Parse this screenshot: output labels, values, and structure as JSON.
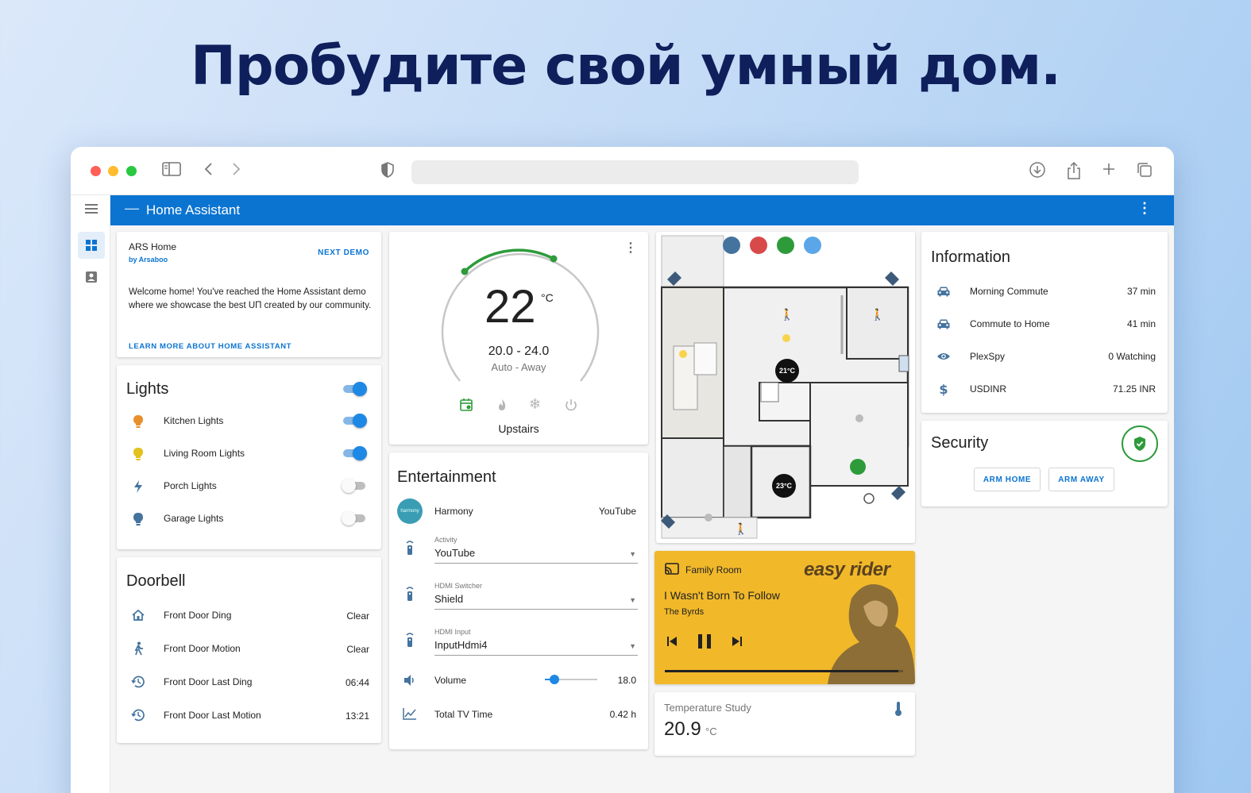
{
  "headline": "Пробудите свой умный дом.",
  "browser": {
    "url_text": ""
  },
  "app": {
    "title": "Home Assistant"
  },
  "intro_card": {
    "home_name": "ARS Home",
    "by_label": "by Arsaboo",
    "next_demo": "NEXT DEMO",
    "welcome_text": "Welcome home! You've reached the Home Assistant demo where we showcase the best UΠ created by our community.",
    "learn_more": "LEARN MORE ABOUT HOME ASSISTANT"
  },
  "lights": {
    "title": "Lights",
    "master_on": true,
    "items": [
      {
        "label": "Kitchen Lights",
        "on": true,
        "icon": "bulb-icon",
        "color": "#e8902c"
      },
      {
        "label": "Living Room Lights",
        "on": true,
        "icon": "bulb-icon",
        "color": "#e3c21d"
      },
      {
        "label": "Porch Lights",
        "on": false,
        "icon": "flash-icon",
        "color": "#44739e"
      },
      {
        "label": "Garage Lights",
        "on": false,
        "icon": "bulb-icon",
        "color": "#44739e"
      }
    ]
  },
  "doorbell": {
    "title": "Doorbell",
    "items": [
      {
        "label": "Front Door Ding",
        "value": "Clear",
        "icon": "home-icon"
      },
      {
        "label": "Front Door Motion",
        "value": "Clear",
        "icon": "walk-icon"
      },
      {
        "label": "Front Door Last Ding",
        "value": "06:44",
        "icon": "history-icon"
      },
      {
        "label": "Front Door Last Motion",
        "value": "13:21",
        "icon": "history-icon"
      }
    ]
  },
  "thermostat": {
    "temperature": "22",
    "unit": "°C",
    "range": "20.0 - 24.0",
    "mode": "Auto - Away",
    "name": "Upstairs",
    "accent_color": "#2e9b3b"
  },
  "entertainment": {
    "title": "Entertainment",
    "harmony_label": "Harmony",
    "harmony_value": "YouTube",
    "harmony_logo_text": "harmony",
    "selects": [
      {
        "label": "Activity",
        "value": "YouTube"
      },
      {
        "label": "HDMI Switcher",
        "value": "Shield"
      },
      {
        "label": "HDMI Input",
        "value": "InputHdmi4"
      }
    ],
    "volume_label": "Volume",
    "volume_value": "18.0",
    "volume_level": 0.18,
    "tv_time_label": "Total TV Time",
    "tv_time_value": "0.42 h"
  },
  "floorplan": {
    "temp1": "21°C",
    "temp2": "23°C"
  },
  "media": {
    "room": "Family Room",
    "track": "I Wasn't Born To Follow",
    "artist": "The Byrds",
    "album_art_text": "easy rider",
    "progress": 0.98,
    "bg_color": "#f1b82a"
  },
  "temperature_study": {
    "label": "Temperature Study",
    "value": "20.9",
    "unit": "°C"
  },
  "information": {
    "title": "Information",
    "items": [
      {
        "label": "Morning Commute",
        "value": "37 min",
        "icon": "car-icon"
      },
      {
        "label": "Commute to Home",
        "value": "41 min",
        "icon": "car-icon"
      },
      {
        "label": "PlexSpy",
        "value": "0 Watching",
        "icon": "eye-icon"
      },
      {
        "label": "USDINR",
        "value": "71.25 INR",
        "icon": "dollar-icon"
      }
    ]
  },
  "security": {
    "title": "Security",
    "arm_home": "ARM HOME",
    "arm_away": "ARM AWAY",
    "status_color": "#2e9b3b"
  }
}
